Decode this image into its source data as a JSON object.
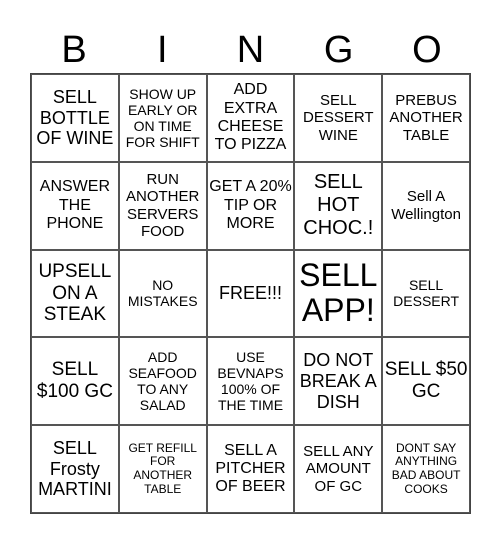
{
  "header": {
    "letters": [
      "B",
      "I",
      "N",
      "G",
      "O"
    ]
  },
  "cells": [
    "SELL BOTTLE OF WINE",
    "SHOW UP EARLY OR ON TIME FOR SHIFT",
    "ADD EXTRA CHEESE TO PIZZA",
    "SELL DESSERT WINE",
    "PREBUS ANOTHER TABLE",
    "ANSWER THE PHONE",
    "RUN ANOTHER SERVERS FOOD",
    "GET A 20% TIP OR MORE",
    "SELL HOT CHOC.!",
    "Sell A Wellington",
    "UPSELL ON A STEAK",
    "NO MISTAKES",
    "FREE!!!",
    "SELL APP!",
    "SELL DESSERT",
    "SELL $100 GC",
    "ADD SEAFOOD TO ANY SALAD",
    "USE BEVNAPS 100% OF THE TIME",
    "DO NOT BREAK A DISH",
    "SELL $50 GC",
    "SELL Frosty MARTINI",
    "GET REFILL FOR ANOTHER TABLE",
    "SELL A PITCHER OF BEER",
    "SELL ANY AMOUNT OF GC",
    "DONT SAY ANYTHING BAD ABOUT COOKS"
  ]
}
